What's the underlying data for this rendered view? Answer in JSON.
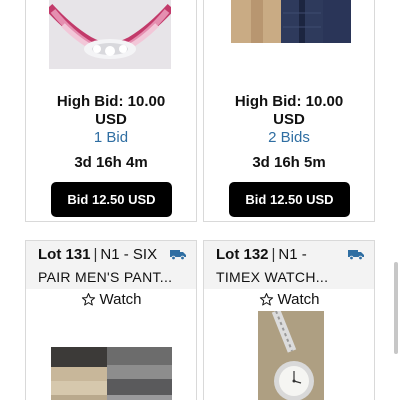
{
  "top_cards": [
    {
      "high_bid": "High Bid: 10.00",
      "currency": "USD",
      "bids": "1 Bid",
      "time_left": "3d 16h 4m",
      "bid_button": "Bid 12.50 USD"
    },
    {
      "high_bid": "High Bid: 10.00",
      "currency": "USD",
      "bids": "2 Bids",
      "time_left": "3d 16h 5m",
      "bid_button": "Bid 12.50 USD"
    }
  ],
  "bottom_cards": [
    {
      "lot": "Lot 131",
      "title_line1": "N1 - SIX",
      "title_line2": "PAIR MEN'S PANT...",
      "watch_label": "Watch",
      "icons": [
        "truck-icon",
        "star-outline-icon"
      ]
    },
    {
      "lot": "Lot 132",
      "title_line1": "N1 -",
      "title_line2": "TIMEX WATCH...",
      "watch_label": "Watch",
      "icons": [
        "truck-icon",
        "star-outline-icon"
      ]
    }
  ],
  "colors": {
    "bid_count": "#2f6ea2",
    "button_bg": "#000000",
    "truck": "#2f6ea2"
  }
}
